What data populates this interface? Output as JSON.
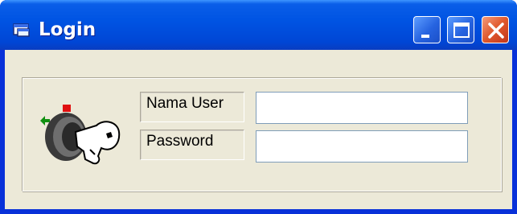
{
  "window": {
    "title": "Login",
    "icon": "window-app-icon",
    "controls": [
      "minimize-icon",
      "maximize-icon",
      "close-icon"
    ]
  },
  "form": {
    "username_label": "Nama User",
    "username_value": "",
    "password_label": "Password",
    "password_value": ""
  },
  "colors": {
    "titlebar": "#0054e3",
    "client_bg": "#ece9d8",
    "close_button": "#e0582c"
  }
}
